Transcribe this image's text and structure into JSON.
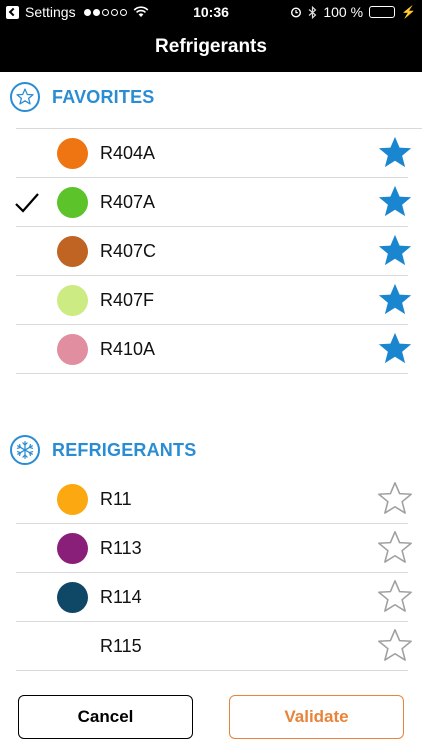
{
  "status_bar": {
    "carrier": "Settings",
    "time": "10:36",
    "battery": "100 %",
    "signal_bars_filled": 2,
    "signal_bars_total": 5,
    "battery_level": 1.0
  },
  "nav": {
    "title": "Refrigerants"
  },
  "favorites": {
    "title": "FAVORITES",
    "icon": "star-outline-icon",
    "items": [
      {
        "name": "R404A",
        "color": "#ee7512",
        "favorite": true,
        "selected": false
      },
      {
        "name": "R407A",
        "color": "#5cc32a",
        "favorite": true,
        "selected": true
      },
      {
        "name": "R407C",
        "color": "#c06424",
        "favorite": true,
        "selected": false
      },
      {
        "name": "R407F",
        "color": "#cdeb83",
        "favorite": true,
        "selected": false
      },
      {
        "name": "R410A",
        "color": "#e08ea0",
        "favorite": true,
        "selected": false
      }
    ]
  },
  "refrigerants": {
    "title": "REFRIGERANTS",
    "icon": "snowflake-icon",
    "items": [
      {
        "name": "R11",
        "color": "#fba811",
        "favorite": false,
        "selected": false
      },
      {
        "name": "R113",
        "color": "#8a1f7a",
        "favorite": false,
        "selected": false
      },
      {
        "name": "R114",
        "color": "#0e4866",
        "favorite": false,
        "selected": false
      },
      {
        "name": "R115",
        "color": "",
        "favorite": false,
        "selected": false
      }
    ]
  },
  "footer": {
    "cancel_label": "Cancel",
    "validate_label": "Validate"
  },
  "colors": {
    "accent_blue": "#2a8dd4",
    "validate_orange": "#e8843a",
    "star_filled": "#1a86d0",
    "star_outline": "#a0a0a0"
  }
}
